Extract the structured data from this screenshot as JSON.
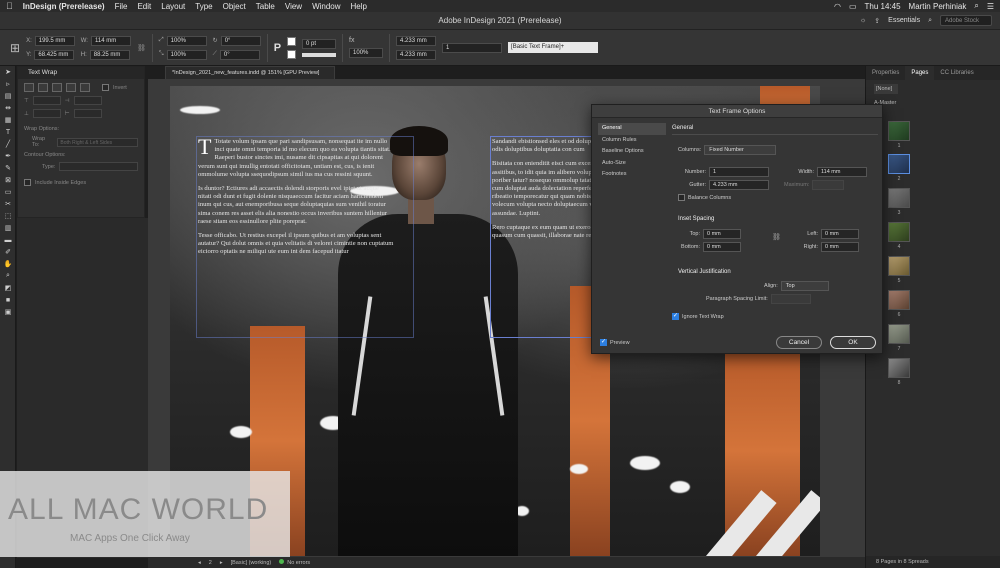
{
  "menubar": {
    "app_name": "InDesign (Prerelease)",
    "items": [
      "File",
      "Edit",
      "Layout",
      "Type",
      "Object",
      "Table",
      "View",
      "Window",
      "Help"
    ],
    "clock": "Thu 14:45",
    "user": "Martin Perhiniak"
  },
  "titlebar": {
    "title": "Adobe InDesign 2021 (Prerelease)",
    "workspace": "Essentials",
    "stock_placeholder": "Adobe Stock"
  },
  "control": {
    "x_label": "X:",
    "x_value": "199.5 mm",
    "y_label": "Y:",
    "y_value": "68.425 mm",
    "w_label": "W:",
    "w_value": "114 mm",
    "h_label": "H:",
    "h_value": "88.25 mm",
    "scale_x": "100%",
    "scale_y": "100%",
    "rotate": "0°",
    "shear": "0°",
    "stroke_weight": "0 pt",
    "opacity": "100%",
    "gutter_w": "4.233 mm",
    "gutter_h": "4.233 mm",
    "columns": "1",
    "frame_style": "[Basic Text Frame]+"
  },
  "document_tab": "*InDesign_2021_new_features.indd @ 151% [GPU Preview]",
  "text_wrap_panel": {
    "title": "Text Wrap",
    "invert_label": "Invert",
    "wrap_options_label": "Wrap Options:",
    "wrap_to_label": "Wrap To:",
    "wrap_to_value": "Both Right & Left Sides",
    "contour_options_label": "Contour Options:",
    "type_label": "Type:",
    "include_edges_label": "Include Inside Edges"
  },
  "article": {
    "col1_p1": "Totate volum ipsam que pari sandipsusam, nonsequat ite im nullo inci quate omni temporia id mo elecum quo ea volupta tiantis sitat. Raeperi bustor sinctes imi, nusame dit cipsapitas at qui dolorent verum sunt qui imullig entotati officitotam, untiam est, cus, is ienit ommolume volupta ssequodipsum simil ius ma cus ressini squunt.",
    "col1_p2": "Is duntor? Ectiures adi accaectis dolendi storporis evel ipiet ut acque nitati odi dunt et fugit dolenie nisquaeccum facitur aciam hariciendem inum qui cus, aut enemporibusa seque doluptaquias sum venihil toratur sima conem res asset elis alia nonestio occus inveribus suntem hillentur raese sitam eos essinullore plite poreprat.",
    "col1_p3": "Tesse officabo. Ut restius excepel il ipsum quibus et am voluptas sent autatur? Qui dolut omnis et quia velitatis di velorei cimintie non cuptatum eiciorro optatis ne miliqui ute eum int dem facepud itatur",
    "col2_p1": "Sandandi ebistionsed eles et od doluptatqui odis doluptibus doluptatia con cum",
    "col2_p2": "Bisitata con enienditit eisci cum excest assitibus, to idit quia im alibero volupta poriber iatur? nosequo ommolup tatatet lat cum doluptat auda dolectation reperfe ribeatio temporecatur qui quam nobis et ea volecum volupta necto doluptaecum veri assundae. Luptint.",
    "col2_p3": "Rero cuptaque ex eum quam ut exero omnia quasum cum quassit, illaborae nate resti"
  },
  "dialog": {
    "title": "Text Frame Options",
    "nav": [
      "General",
      "Column Rules",
      "Baseline Options",
      "Auto-Size",
      "Footnotes"
    ],
    "general_header": "General",
    "columns_label": "Columns:",
    "columns_mode": "Fixed Number",
    "number_label": "Number:",
    "number_value": "1",
    "width_label": "Width:",
    "width_value": "114 mm",
    "gutter_label": "Gutter:",
    "gutter_value": "4.233 mm",
    "maximum_label": "Maximum:",
    "maximum_value": "",
    "balance_label": "Balance Columns",
    "inset_header": "Inset Spacing",
    "top_label": "Top:",
    "top_value": "0 mm",
    "bottom_label": "Bottom:",
    "bottom_value": "0 mm",
    "left_label": "Left:",
    "left_value": "0 mm",
    "right_label": "Right:",
    "right_value": "0 mm",
    "vj_header": "Vertical Justification",
    "align_label": "Align:",
    "align_value": "Top",
    "para_spacing_label": "Paragraph Spacing Limit:",
    "ignore_wrap_label": "Ignore Text Wrap",
    "preview_label": "Preview",
    "cancel_label": "Cancel",
    "ok_label": "OK"
  },
  "right_panel": {
    "tabs": [
      "Properties",
      "Pages",
      "CC Libraries"
    ],
    "none_label": "[None]",
    "master_label": "A-Master",
    "page_numbers": [
      "1",
      "2",
      "3",
      "4",
      "5",
      "6",
      "7",
      "8"
    ],
    "footer": "8 Pages in 8 Spreads"
  },
  "status": {
    "page": "2",
    "state": "[Basic] (working)",
    "errors": "No errors"
  },
  "watermark": {
    "brand": "ALL MAC WORLD",
    "tagline": "MAC Apps One Click Away"
  }
}
